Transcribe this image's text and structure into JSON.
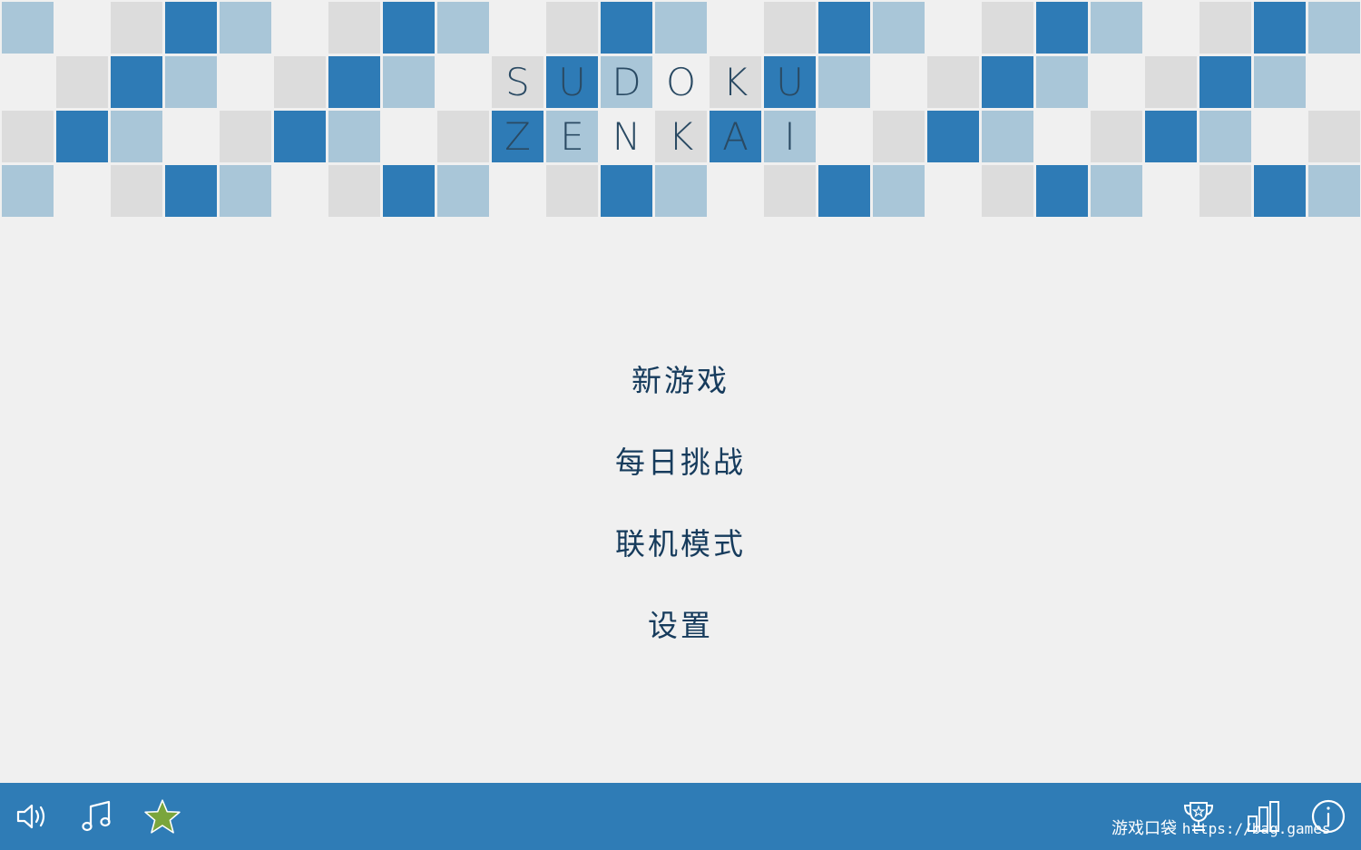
{
  "title": {
    "line1": [
      "S",
      "U",
      "D",
      "O",
      "K",
      "U"
    ],
    "line2": [
      "Z",
      "E",
      "N",
      "K",
      "A",
      "I"
    ]
  },
  "tile_grid": [
    [
      2,
      0,
      1,
      3,
      2,
      0,
      1,
      3,
      2,
      0,
      1,
      3,
      2,
      0,
      1,
      3,
      2,
      0,
      1,
      3,
      2,
      0,
      1,
      3,
      2
    ],
    [
      0,
      1,
      3,
      2,
      0,
      1,
      3,
      2,
      0,
      1,
      3,
      2,
      0,
      1,
      3,
      2,
      0,
      1,
      3,
      2,
      0,
      1,
      3,
      2,
      0
    ],
    [
      1,
      3,
      2,
      0,
      1,
      3,
      2,
      0,
      1,
      3,
      2,
      0,
      1,
      3,
      2,
      0,
      1,
      3,
      2,
      0,
      1,
      3,
      2,
      0,
      1
    ],
    [
      2,
      0,
      1,
      3,
      2,
      0,
      1,
      3,
      2,
      0,
      1,
      3,
      2,
      0,
      1,
      3,
      2,
      0,
      1,
      3,
      2,
      0,
      1,
      3,
      2
    ]
  ],
  "tile_colors": [
    "#f0f0f0",
    "#dcdcdc",
    "#a9c6d8",
    "#2e7bb6"
  ],
  "menu": {
    "new_game": "新游戏",
    "daily_challenge": "每日挑战",
    "online_mode": "联机模式",
    "settings": "设置"
  },
  "bottom_bar": {
    "color": "#2f7cb6",
    "left_icons": [
      "speaker-icon",
      "music-note-icon",
      "star-icon"
    ],
    "right_icons": [
      "trophy-icon",
      "bar-chart-icon",
      "info-icon"
    ],
    "star_color": "#7aa53c"
  },
  "watermark": {
    "label": "游戏口袋",
    "url": "https://bag.games"
  }
}
